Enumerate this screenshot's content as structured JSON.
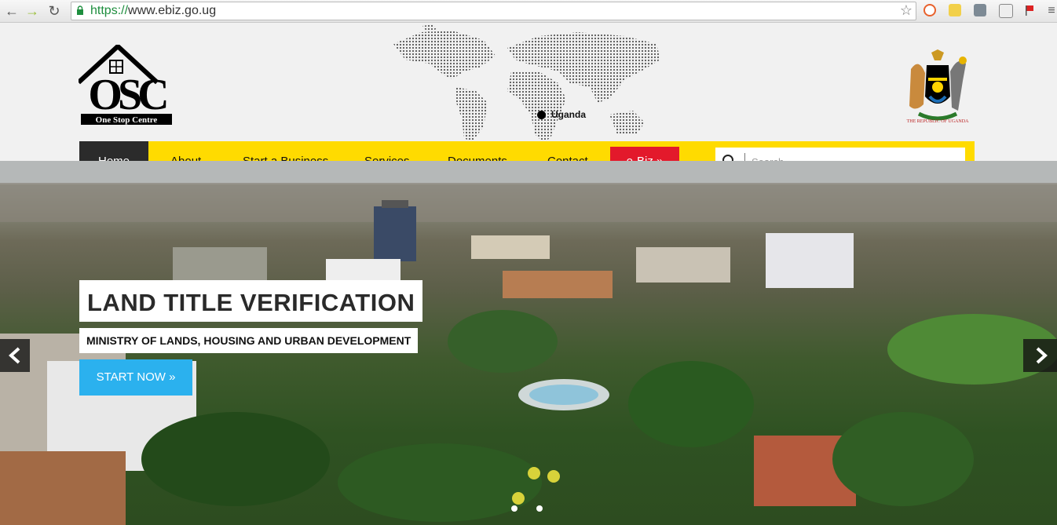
{
  "browser": {
    "url_scheme": "https://",
    "url_host": "www.ebiz.go.ug",
    "back_icon": "back-arrow-icon",
    "forward_icon": "forward-arrow-icon",
    "reload_icon": "reload-icon"
  },
  "header": {
    "logo_text": "OSC",
    "logo_subtext": "One Stop Centre",
    "map_label": "Uganda",
    "coat_of_arms_text": "THE REPUBLIC OF UGANDA"
  },
  "nav": {
    "items": [
      {
        "label": "Home",
        "active": true
      },
      {
        "label": "About"
      },
      {
        "label": "Start a Business"
      },
      {
        "label": "Services"
      },
      {
        "label": "Documents"
      },
      {
        "label": "Contact"
      }
    ],
    "ebiz_label": "e-Biz »",
    "search_placeholder": "Search..."
  },
  "hero": {
    "headline": "LAND TITLE VERIFICATION",
    "subhead": "MINISTRY OF LANDS, HOUSING AND URBAN DEVELOPMENT",
    "cta_label": "START NOW »",
    "slide_count": 2
  },
  "colors": {
    "nav_bg": "#ffdb00",
    "active_bg": "#2b2b2b",
    "ebiz_bg": "#e3192b",
    "cta_bg": "#2bb1ee"
  }
}
